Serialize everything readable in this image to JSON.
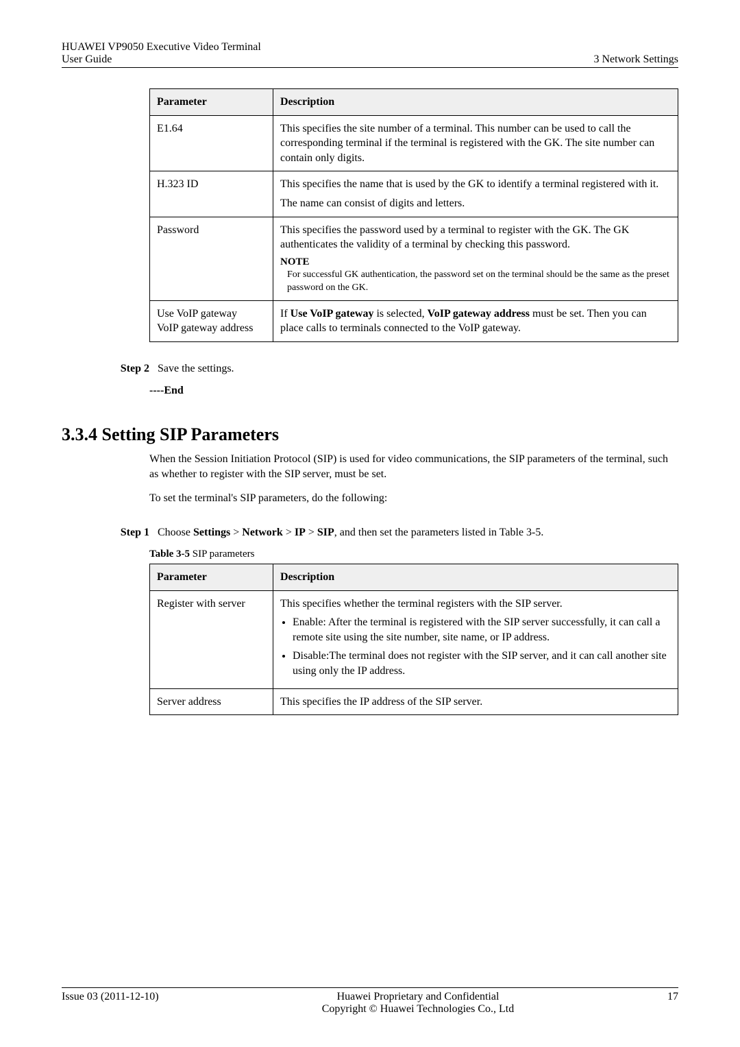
{
  "header": {
    "product": "HUAWEI VP9050 Executive Video Terminal",
    "doc": "User Guide",
    "chapter": "3 Network Settings"
  },
  "table1": {
    "head_param": "Parameter",
    "head_desc": "Description",
    "rows": [
      {
        "param": "E1.64",
        "desc": "This specifies the site number of a terminal. This number can be used to call the corresponding terminal if the terminal is registered with the GK. The site number can contain only digits."
      },
      {
        "param": "H.323 ID",
        "desc_line1": "This specifies the name that is used by the GK to identify a terminal registered with it.",
        "desc_line2": "The name can consist of digits and letters."
      },
      {
        "param": "Password",
        "desc_line1": "This specifies the password used by a terminal to register with the GK. The GK authenticates the validity of a terminal by checking this password.",
        "note_label": "NOTE",
        "note_body": "For successful GK authentication, the password set on the terminal should be the same as the preset password on the GK."
      },
      {
        "param_line1": "Use VoIP gateway",
        "param_line2": "VoIP gateway address",
        "desc_pre": "If ",
        "desc_b1": "Use VoIP gateway",
        "desc_mid1": " is selected, ",
        "desc_b2": "VoIP gateway address",
        "desc_post": " must be set. Then you can place calls to terminals connected to the VoIP gateway."
      }
    ]
  },
  "step2": {
    "label": "Step 2",
    "body": "Save the settings."
  },
  "end": "----End",
  "section": {
    "number": "3.3.4",
    "title": "Setting SIP Parameters",
    "para1": "When the Session Initiation Protocol (SIP) is used for video communications, the SIP parameters of the terminal, such as whether to register with the SIP server, must be set.",
    "para2": "To set the terminal's SIP parameters, do the following:"
  },
  "step1": {
    "label": "Step 1",
    "pre": "Choose ",
    "b1": "Settings",
    "sep": " > ",
    "b2": "Network",
    "b3": "IP",
    "b4": "SIP",
    "post": ", and then set the parameters listed in Table 3-5."
  },
  "table2": {
    "caption_bold": "Table 3-5",
    "caption_rest": " SIP parameters",
    "head_param": "Parameter",
    "head_desc": "Description",
    "rows": [
      {
        "param": "Register with server",
        "desc_intro": "This specifies whether the terminal registers with the SIP server.",
        "bullet1": "Enable: After the terminal is registered with the SIP server successfully, it can call a remote site using the site number, site name, or IP address.",
        "bullet2": "Disable:The terminal does not register with the SIP server, and it can call another site using only the IP address."
      },
      {
        "param": "Server address",
        "desc": "This specifies the IP address of the SIP server."
      }
    ]
  },
  "footer": {
    "issue": "Issue 03 (2011-12-10)",
    "center1": "Huawei Proprietary and Confidential",
    "center2": "Copyright © Huawei Technologies Co., Ltd",
    "page": "17"
  }
}
